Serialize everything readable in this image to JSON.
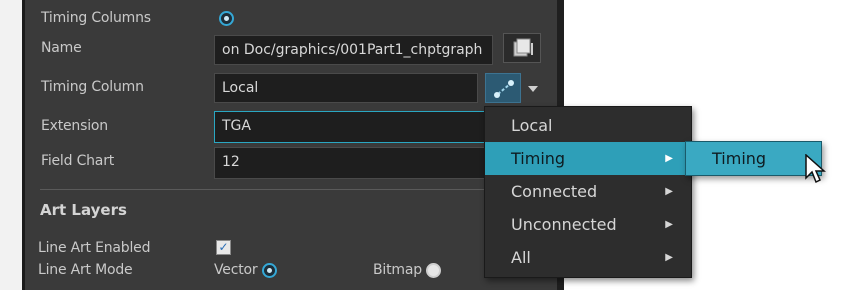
{
  "panel": {
    "timing_columns_label": "Timing Columns",
    "name_label": "Name",
    "name_value": "on Doc/graphics/001Part1_chptgraph",
    "timing_column_label": "Timing Column",
    "timing_column_value": "Local",
    "extension_label": "Extension",
    "extension_value": "TGA",
    "field_chart_label": "Field Chart",
    "field_chart_value": "12",
    "art_layers_title": "Art Layers",
    "line_art_enabled_label": "Line Art Enabled",
    "line_art_mode_label": "Line Art Mode",
    "vector_label": "Vector",
    "bitmap_label": "Bitmap"
  },
  "dropdown_menu": {
    "items": [
      {
        "label": "Local"
      },
      {
        "label": "Timing",
        "has_submenu": true,
        "highlighted": true
      },
      {
        "label": "Connected",
        "has_submenu": true
      },
      {
        "label": "Unconnected",
        "has_submenu": true
      },
      {
        "label": "All",
        "has_submenu": true
      }
    ],
    "arrow_glyph": "▶"
  },
  "submenu": {
    "items": [
      {
        "label": "Timing"
      }
    ]
  },
  "state": {
    "timing_columns_selected": true,
    "line_art_enabled_checked": true,
    "line_art_mode": "Vector"
  },
  "icons": {
    "browse": "browse-icon",
    "connect": "node-connect-icon",
    "dropdown": "chevron-down-icon",
    "cursor": "mouse-cursor-icon"
  },
  "colors": {
    "panel_bg": "#3a3a3a",
    "field_bg": "#1e1e1e",
    "accent": "#2e9fb8",
    "radio_on": "#35a8d6"
  }
}
